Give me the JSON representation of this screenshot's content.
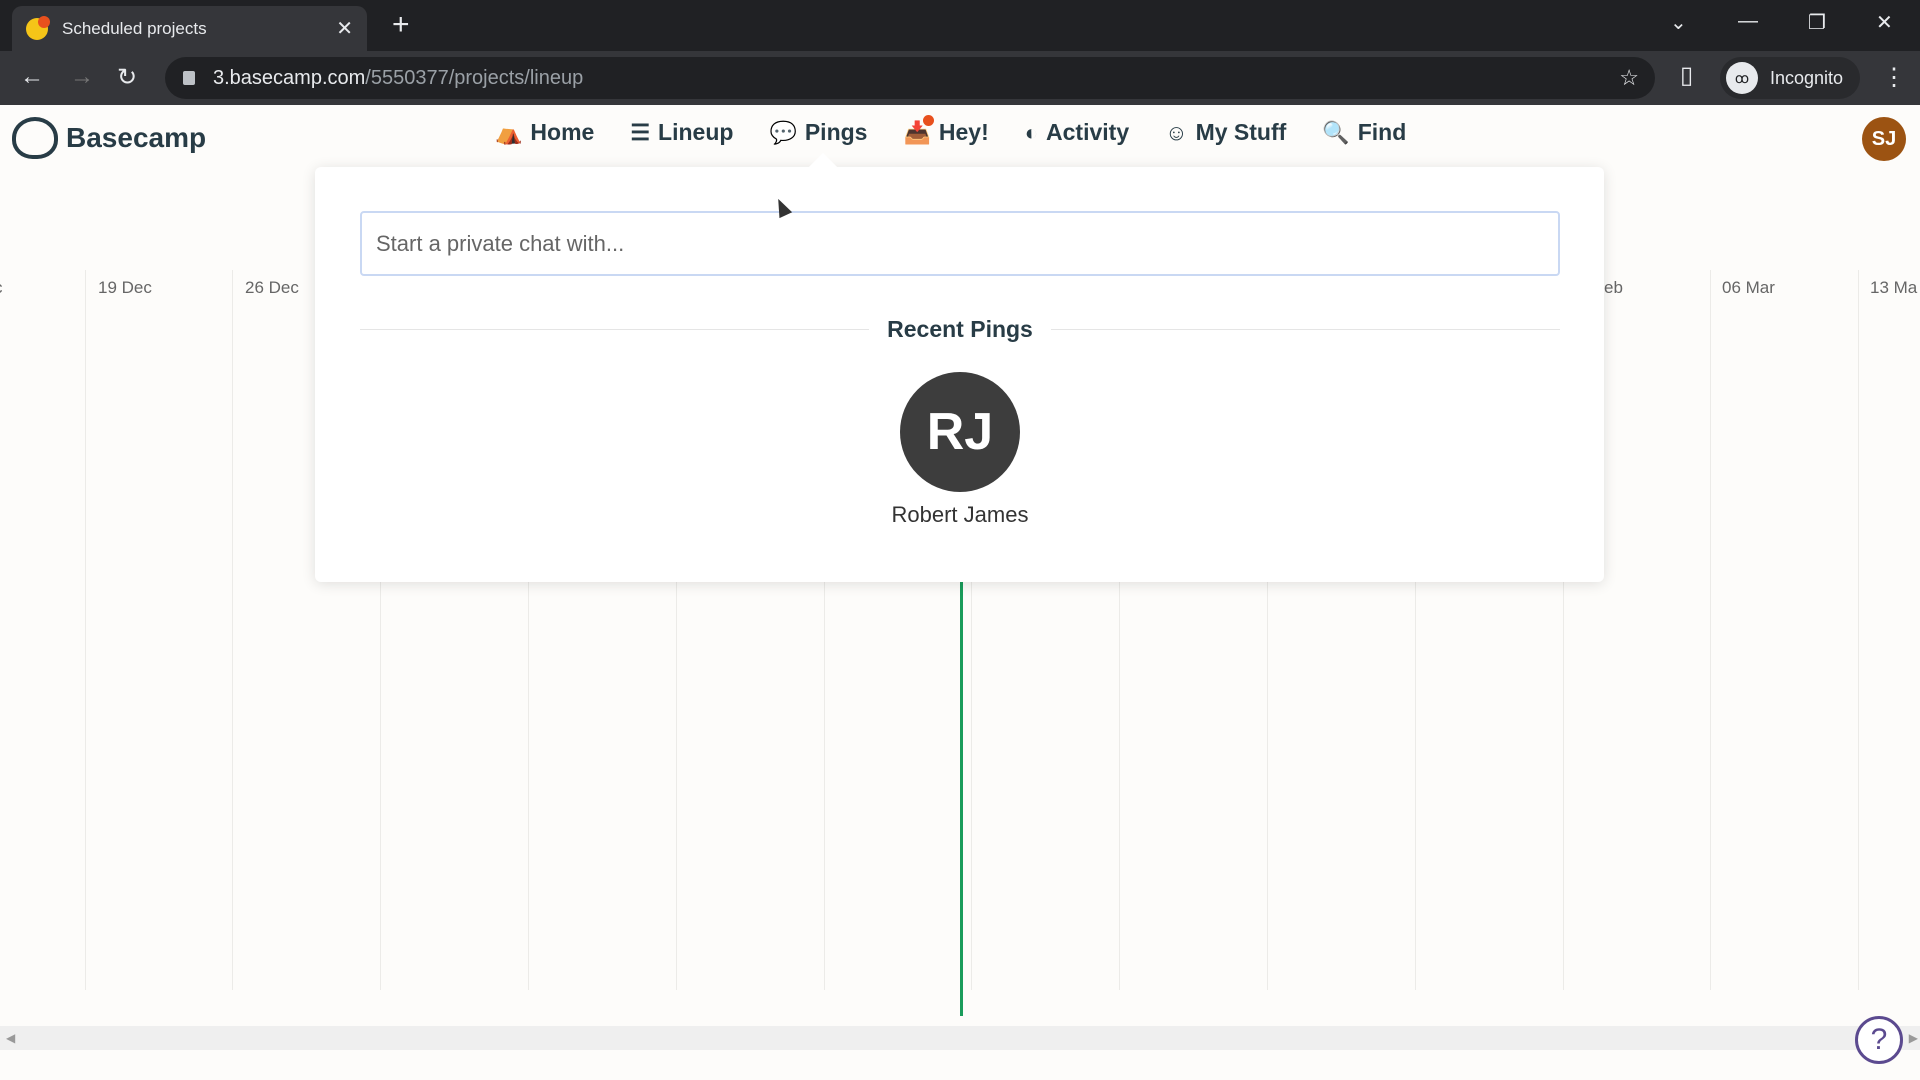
{
  "browser": {
    "tab_title": "Scheduled projects",
    "url_host": "3.basecamp.com",
    "url_path": "/5550377/projects/lineup",
    "profile": "Incognito"
  },
  "app": {
    "logo": "Basecamp",
    "avatar_initials": "SJ",
    "nav": [
      {
        "label": "Home",
        "icon": "home-icon"
      },
      {
        "label": "Lineup",
        "icon": "lineup-icon"
      },
      {
        "label": "Pings",
        "icon": "pings-icon"
      },
      {
        "label": "Hey!",
        "icon": "hey-icon"
      },
      {
        "label": "Activity",
        "icon": "activity-icon"
      },
      {
        "label": "My Stuff",
        "icon": "smiley-icon"
      },
      {
        "label": "Find",
        "icon": "search-icon"
      }
    ]
  },
  "timeline": {
    "dates": [
      "c",
      "19 Dec",
      "26 Dec",
      "eb",
      "06 Mar",
      "13 Ma"
    ]
  },
  "pings": {
    "placeholder": "Start a private chat with...",
    "section_title": "Recent Pings",
    "recent": [
      {
        "initials": "RJ",
        "name": "Robert James"
      }
    ]
  },
  "colors": {
    "accent": "#1a9c5b",
    "avatar_me": "#9c5312",
    "help": "#5b4a8f"
  }
}
